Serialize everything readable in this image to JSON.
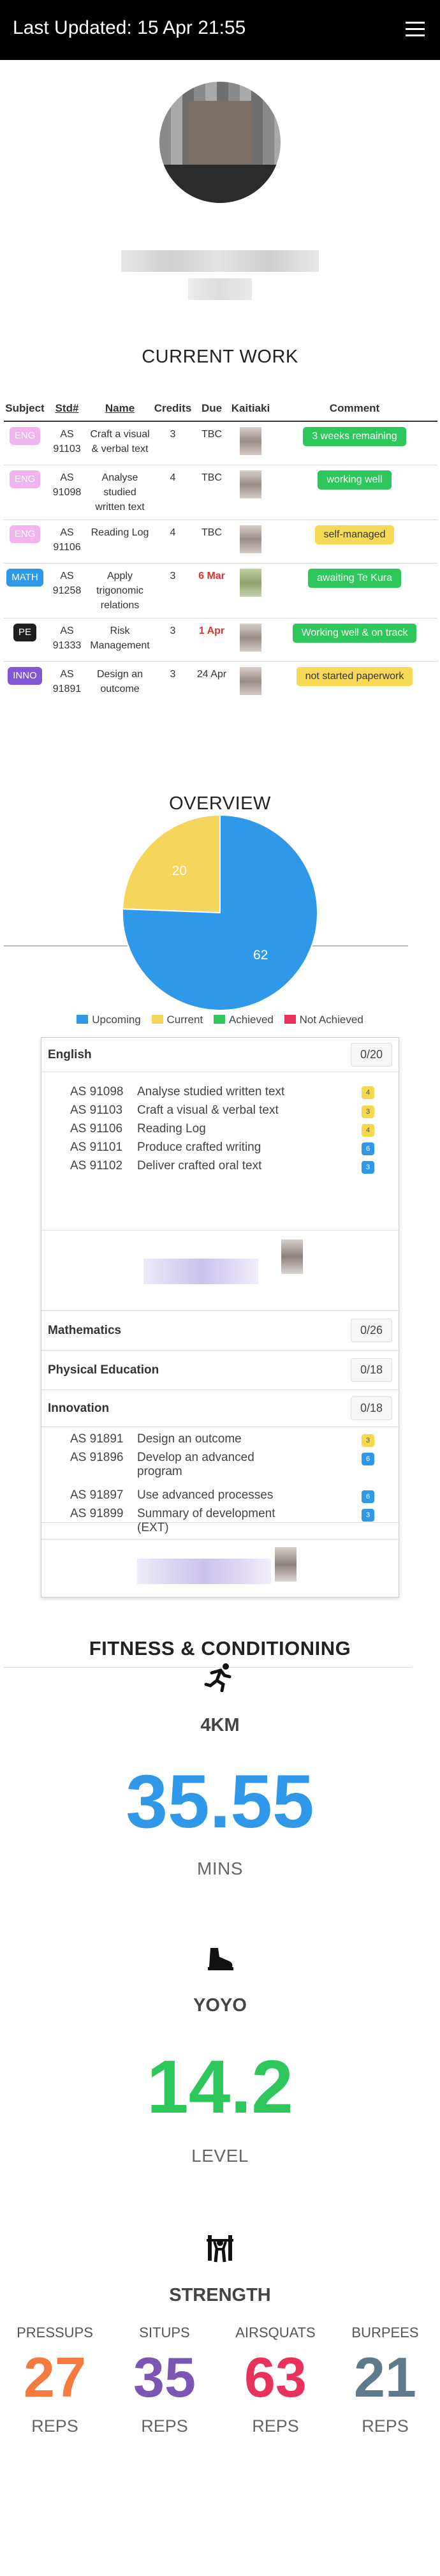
{
  "header": {
    "title": "Last Updated: 15 Apr 21:55"
  },
  "current_work": {
    "title": "CURRENT WORK",
    "columns": [
      "Subject",
      "Std#",
      "Name",
      "Credits",
      "Due",
      "Kaitiaki",
      "Comment"
    ],
    "rows": [
      {
        "subject": "ENG",
        "std_line1": "AS",
        "std_line2": "91103",
        "name": "Craft a visual & verbal text",
        "credits": "3",
        "due": "TBC",
        "comment": "3 weeks remaining"
      },
      {
        "subject": "ENG",
        "std_line1": "AS",
        "std_line2": "91098",
        "name": "Analyse studied written text",
        "credits": "4",
        "due": "TBC",
        "comment": "working well"
      },
      {
        "subject": "ENG",
        "std_line1": "AS",
        "std_line2": "91106",
        "name": "Reading Log",
        "credits": "4",
        "due": "TBC",
        "comment": "self-managed"
      },
      {
        "subject": "MATH",
        "std_line1": "AS",
        "std_line2": "91258",
        "name": "Apply trigonomic relations",
        "credits": "3",
        "due": "6 Mar",
        "comment": "awaiting Te Kura"
      },
      {
        "subject": "PE",
        "std_line1": "AS",
        "std_line2": "91333",
        "name": "Risk Management",
        "credits": "3",
        "due": "1 Apr",
        "comment": "Working well & on track"
      },
      {
        "subject": "INNO",
        "std_line1": "AS",
        "std_line2": "91891",
        "name": "Design an outcome",
        "credits": "3",
        "due": "24 Apr",
        "comment": "not started paperwork"
      }
    ]
  },
  "overview": {
    "title": "OVERVIEW",
    "legend": [
      "Upcoming",
      "Current",
      "Achieved",
      "Not Achieved"
    ],
    "colors": {
      "upcoming": "#2f98e8",
      "current": "#f6d55c",
      "achieved": "#2ec75c",
      "not_achieved": "#e8315b"
    }
  },
  "chart_data": {
    "type": "pie",
    "categories": [
      "Upcoming",
      "Current"
    ],
    "values": [
      62,
      20
    ],
    "labels_shown": [
      "62",
      "20"
    ],
    "legend": [
      "Upcoming",
      "Current",
      "Achieved",
      "Not Achieved"
    ],
    "legend_position": "bottom"
  },
  "standards": {
    "english": {
      "name": "English",
      "score": "0/20",
      "items": [
        {
          "code": "AS 91098",
          "name": "Analyse studied written text",
          "credits": "4"
        },
        {
          "code": "AS 91103",
          "name": "Craft a visual & verbal text",
          "credits": "3"
        },
        {
          "code": "AS 91106",
          "name": "Reading Log",
          "credits": "4"
        },
        {
          "code": "AS 91101",
          "name": "Produce crafted writing",
          "credits": "6"
        },
        {
          "code": "AS 91102",
          "name": "Deliver crafted oral text",
          "credits": "3"
        }
      ]
    },
    "mathematics": {
      "name": "Mathematics",
      "score": "0/26"
    },
    "pe": {
      "name": "Physical Education",
      "score": "0/18"
    },
    "innovation": {
      "name": "Innovation",
      "score": "0/18",
      "items": [
        {
          "code": "AS 91891",
          "name": "Design an outcome",
          "credits": "3"
        },
        {
          "code": "AS 91896",
          "name": "Develop an advanced program",
          "credits": "6"
        },
        {
          "code": "AS 91897",
          "name": "Use advanced processes",
          "credits": "6"
        },
        {
          "code": "AS 91899",
          "name": "Summary of development (EXT)",
          "credits": "3"
        }
      ]
    }
  },
  "fitness": {
    "title": "FITNESS & CONDITIONING",
    "run": {
      "icon": "running-icon",
      "label": "4KM",
      "value": "35.55",
      "unit": "MINS",
      "color": "#2f98e8"
    },
    "yoyo": {
      "icon": "shoe-icon",
      "label": "YOYO",
      "value": "14.2",
      "unit": "LEVEL",
      "color": "#2ec75c"
    },
    "strength": {
      "icon": "weightlifter-icon",
      "label": "STRENGTH",
      "items": [
        {
          "label": "PRESSUPS",
          "value": "27",
          "unit": "REPS",
          "color": "#f47b3d"
        },
        {
          "label": "SITUPS",
          "value": "35",
          "unit": "REPS",
          "color": "#7b57b3"
        },
        {
          "label": "AIRSQUATS",
          "value": "63",
          "unit": "REPS",
          "color": "#e8315b"
        },
        {
          "label": "BURPEES",
          "value": "21",
          "unit": "REPS",
          "color": "#5f7a8a"
        }
      ]
    }
  }
}
